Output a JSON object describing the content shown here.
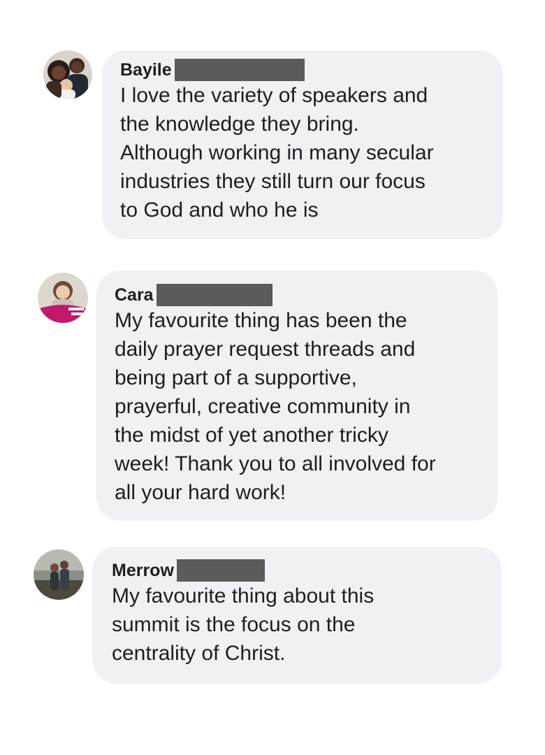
{
  "comments": [
    {
      "author": "Bayile",
      "text": "I love the variety of speakers and\nthe knowledge they bring.\nAlthough working in many secular\nindustries they still turn our focus\nto God and who he is"
    },
    {
      "author": "Cara",
      "text": "My favourite thing has been the\ndaily prayer request threads and\nbeing part of a supportive,\nprayerful, creative community in\nthe midst of yet another tricky\nweek! Thank you to all involved for\nall your hard work!"
    },
    {
      "author": "Merrow",
      "text": "My favourite thing about this\nsummit is the focus on the\ncentrality of Christ."
    }
  ],
  "colors": {
    "bubble": "#f0f1f5",
    "redaction": "#5b5b5b",
    "text": "#1c1e21"
  }
}
